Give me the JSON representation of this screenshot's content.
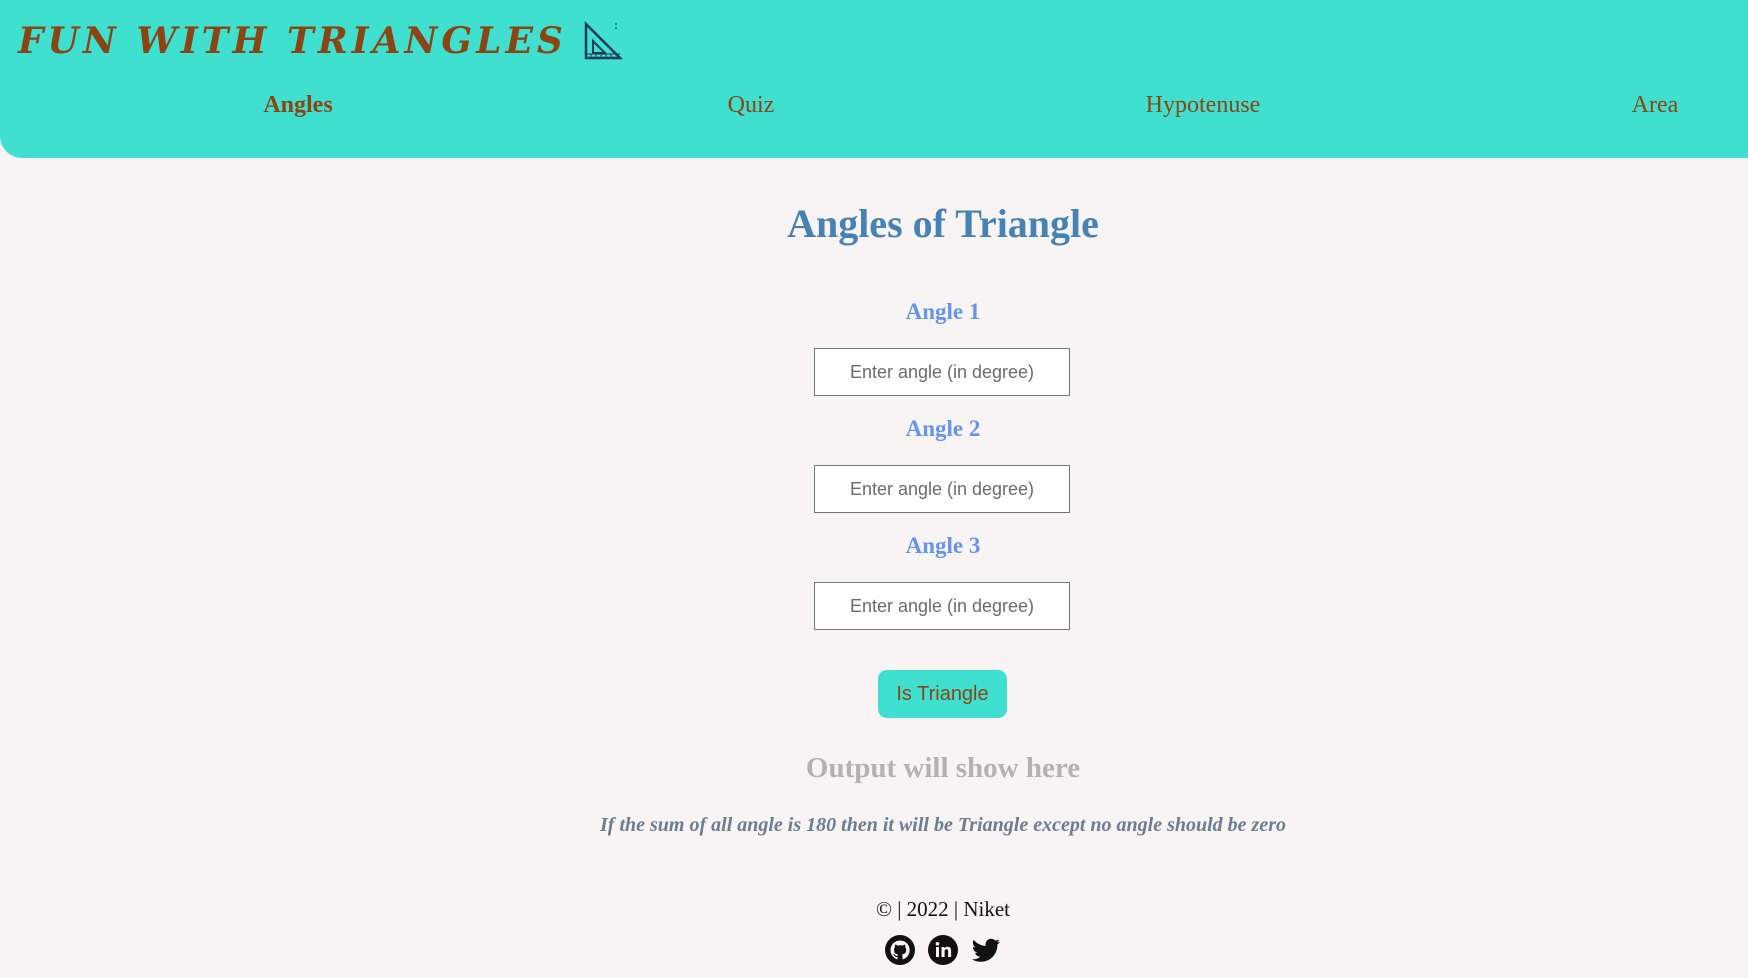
{
  "header": {
    "brand_title": "FUN WITH TRIANGLES",
    "brand_icon": "set-square-icon",
    "nav": [
      {
        "label": "Angles",
        "active": true
      },
      {
        "label": "Quiz",
        "active": false
      },
      {
        "label": "Hypotenuse",
        "active": false
      },
      {
        "label": "Area",
        "active": false
      }
    ]
  },
  "main": {
    "title": "Angles of Triangle",
    "fields": [
      {
        "label": "Angle 1",
        "placeholder": "Enter angle (in degree)",
        "value": ""
      },
      {
        "label": "Angle 2",
        "placeholder": "Enter angle (in degree)",
        "value": ""
      },
      {
        "label": "Angle 3",
        "placeholder": "Enter angle (in degree)",
        "value": ""
      }
    ],
    "button_label": "Is Triangle",
    "output_text": "Output will show here",
    "note": "If the sum of all angle is 180 then it will be Triangle except no angle should be zero"
  },
  "footer": {
    "copyright": "© | 2022 | Niket",
    "socials": [
      "github-icon",
      "linkedin-icon",
      "twitter-icon"
    ]
  },
  "colors": {
    "header_bg": "#40e0d0",
    "brand_text": "#8b4513",
    "title": "#4682b4",
    "label": "#6495ed",
    "page_bg": "#f8f4f3"
  }
}
